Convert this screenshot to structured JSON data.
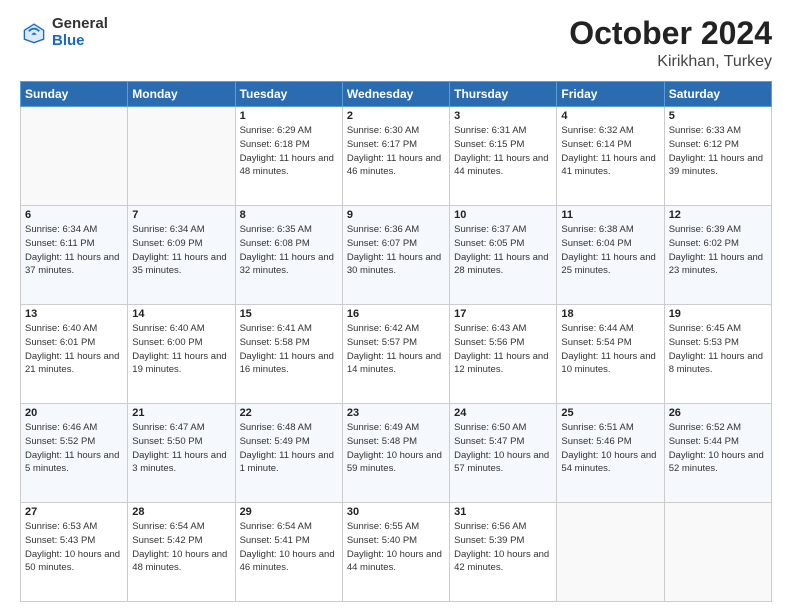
{
  "logo": {
    "general": "General",
    "blue": "Blue"
  },
  "header": {
    "month": "October 2024",
    "location": "Kirikhan, Turkey"
  },
  "days_of_week": [
    "Sunday",
    "Monday",
    "Tuesday",
    "Wednesday",
    "Thursday",
    "Friday",
    "Saturday"
  ],
  "weeks": [
    [
      {
        "day": "",
        "sunrise": "",
        "sunset": "",
        "daylight": ""
      },
      {
        "day": "",
        "sunrise": "",
        "sunset": "",
        "daylight": ""
      },
      {
        "day": "1",
        "sunrise": "Sunrise: 6:29 AM",
        "sunset": "Sunset: 6:18 PM",
        "daylight": "Daylight: 11 hours and 48 minutes."
      },
      {
        "day": "2",
        "sunrise": "Sunrise: 6:30 AM",
        "sunset": "Sunset: 6:17 PM",
        "daylight": "Daylight: 11 hours and 46 minutes."
      },
      {
        "day": "3",
        "sunrise": "Sunrise: 6:31 AM",
        "sunset": "Sunset: 6:15 PM",
        "daylight": "Daylight: 11 hours and 44 minutes."
      },
      {
        "day": "4",
        "sunrise": "Sunrise: 6:32 AM",
        "sunset": "Sunset: 6:14 PM",
        "daylight": "Daylight: 11 hours and 41 minutes."
      },
      {
        "day": "5",
        "sunrise": "Sunrise: 6:33 AM",
        "sunset": "Sunset: 6:12 PM",
        "daylight": "Daylight: 11 hours and 39 minutes."
      }
    ],
    [
      {
        "day": "6",
        "sunrise": "Sunrise: 6:34 AM",
        "sunset": "Sunset: 6:11 PM",
        "daylight": "Daylight: 11 hours and 37 minutes."
      },
      {
        "day": "7",
        "sunrise": "Sunrise: 6:34 AM",
        "sunset": "Sunset: 6:09 PM",
        "daylight": "Daylight: 11 hours and 35 minutes."
      },
      {
        "day": "8",
        "sunrise": "Sunrise: 6:35 AM",
        "sunset": "Sunset: 6:08 PM",
        "daylight": "Daylight: 11 hours and 32 minutes."
      },
      {
        "day": "9",
        "sunrise": "Sunrise: 6:36 AM",
        "sunset": "Sunset: 6:07 PM",
        "daylight": "Daylight: 11 hours and 30 minutes."
      },
      {
        "day": "10",
        "sunrise": "Sunrise: 6:37 AM",
        "sunset": "Sunset: 6:05 PM",
        "daylight": "Daylight: 11 hours and 28 minutes."
      },
      {
        "day": "11",
        "sunrise": "Sunrise: 6:38 AM",
        "sunset": "Sunset: 6:04 PM",
        "daylight": "Daylight: 11 hours and 25 minutes."
      },
      {
        "day": "12",
        "sunrise": "Sunrise: 6:39 AM",
        "sunset": "Sunset: 6:02 PM",
        "daylight": "Daylight: 11 hours and 23 minutes."
      }
    ],
    [
      {
        "day": "13",
        "sunrise": "Sunrise: 6:40 AM",
        "sunset": "Sunset: 6:01 PM",
        "daylight": "Daylight: 11 hours and 21 minutes."
      },
      {
        "day": "14",
        "sunrise": "Sunrise: 6:40 AM",
        "sunset": "Sunset: 6:00 PM",
        "daylight": "Daylight: 11 hours and 19 minutes."
      },
      {
        "day": "15",
        "sunrise": "Sunrise: 6:41 AM",
        "sunset": "Sunset: 5:58 PM",
        "daylight": "Daylight: 11 hours and 16 minutes."
      },
      {
        "day": "16",
        "sunrise": "Sunrise: 6:42 AM",
        "sunset": "Sunset: 5:57 PM",
        "daylight": "Daylight: 11 hours and 14 minutes."
      },
      {
        "day": "17",
        "sunrise": "Sunrise: 6:43 AM",
        "sunset": "Sunset: 5:56 PM",
        "daylight": "Daylight: 11 hours and 12 minutes."
      },
      {
        "day": "18",
        "sunrise": "Sunrise: 6:44 AM",
        "sunset": "Sunset: 5:54 PM",
        "daylight": "Daylight: 11 hours and 10 minutes."
      },
      {
        "day": "19",
        "sunrise": "Sunrise: 6:45 AM",
        "sunset": "Sunset: 5:53 PM",
        "daylight": "Daylight: 11 hours and 8 minutes."
      }
    ],
    [
      {
        "day": "20",
        "sunrise": "Sunrise: 6:46 AM",
        "sunset": "Sunset: 5:52 PM",
        "daylight": "Daylight: 11 hours and 5 minutes."
      },
      {
        "day": "21",
        "sunrise": "Sunrise: 6:47 AM",
        "sunset": "Sunset: 5:50 PM",
        "daylight": "Daylight: 11 hours and 3 minutes."
      },
      {
        "day": "22",
        "sunrise": "Sunrise: 6:48 AM",
        "sunset": "Sunset: 5:49 PM",
        "daylight": "Daylight: 11 hours and 1 minute."
      },
      {
        "day": "23",
        "sunrise": "Sunrise: 6:49 AM",
        "sunset": "Sunset: 5:48 PM",
        "daylight": "Daylight: 10 hours and 59 minutes."
      },
      {
        "day": "24",
        "sunrise": "Sunrise: 6:50 AM",
        "sunset": "Sunset: 5:47 PM",
        "daylight": "Daylight: 10 hours and 57 minutes."
      },
      {
        "day": "25",
        "sunrise": "Sunrise: 6:51 AM",
        "sunset": "Sunset: 5:46 PM",
        "daylight": "Daylight: 10 hours and 54 minutes."
      },
      {
        "day": "26",
        "sunrise": "Sunrise: 6:52 AM",
        "sunset": "Sunset: 5:44 PM",
        "daylight": "Daylight: 10 hours and 52 minutes."
      }
    ],
    [
      {
        "day": "27",
        "sunrise": "Sunrise: 6:53 AM",
        "sunset": "Sunset: 5:43 PM",
        "daylight": "Daylight: 10 hours and 50 minutes."
      },
      {
        "day": "28",
        "sunrise": "Sunrise: 6:54 AM",
        "sunset": "Sunset: 5:42 PM",
        "daylight": "Daylight: 10 hours and 48 minutes."
      },
      {
        "day": "29",
        "sunrise": "Sunrise: 6:54 AM",
        "sunset": "Sunset: 5:41 PM",
        "daylight": "Daylight: 10 hours and 46 minutes."
      },
      {
        "day": "30",
        "sunrise": "Sunrise: 6:55 AM",
        "sunset": "Sunset: 5:40 PM",
        "daylight": "Daylight: 10 hours and 44 minutes."
      },
      {
        "day": "31",
        "sunrise": "Sunrise: 6:56 AM",
        "sunset": "Sunset: 5:39 PM",
        "daylight": "Daylight: 10 hours and 42 minutes."
      },
      {
        "day": "",
        "sunrise": "",
        "sunset": "",
        "daylight": ""
      },
      {
        "day": "",
        "sunrise": "",
        "sunset": "",
        "daylight": ""
      }
    ]
  ]
}
